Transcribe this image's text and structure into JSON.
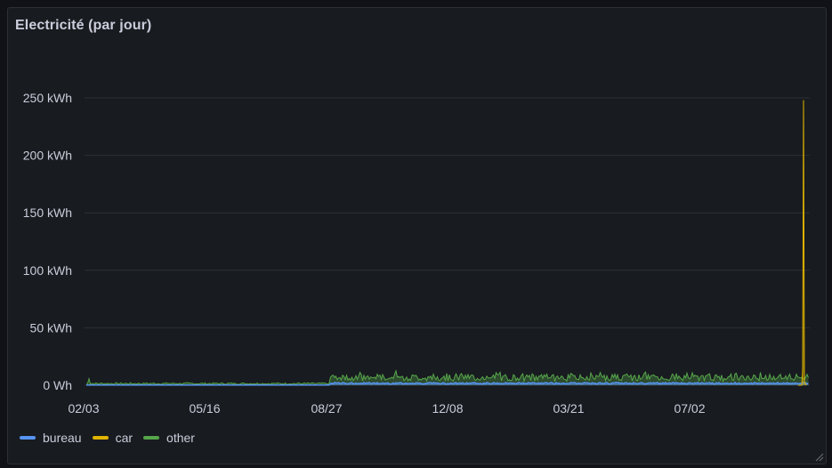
{
  "panel": {
    "title": "Electricité (par jour)"
  },
  "colors": {
    "background": "#111217",
    "panel": "#181b1f",
    "grid": "#2c2f36",
    "text": "#ccccdc",
    "bureau": "#5794f2",
    "car": "#e0b400",
    "other": "#56a64b"
  },
  "icons": {
    "resize": "resize-handle-icon"
  },
  "chart_data": {
    "type": "area",
    "title": "Electricité (par jour)",
    "ylim": [
      0,
      250
    ],
    "y_unit": "kWh",
    "y_ticks": [
      "0 Wh",
      "50 kWh",
      "100 kWh",
      "150 kWh",
      "200 kWh",
      "250 kWh"
    ],
    "y_tick_values": [
      0,
      50,
      100,
      150,
      200,
      250
    ],
    "x_ticks": [
      "02/03",
      "05/16",
      "08/27",
      "12/08",
      "03/21",
      "07/02"
    ],
    "legend_placement": "bottom-left",
    "grid": true,
    "series": [
      {
        "name": "bureau",
        "color": "#5794f2",
        "segments": [
          {
            "from": "02/03",
            "to": "08/27",
            "approx_value": 0.3
          },
          {
            "from": "08/27",
            "to": "end",
            "approx_value": 2
          }
        ]
      },
      {
        "name": "car",
        "color": "#e0b400",
        "segments": [
          {
            "from": "02/03",
            "to": "end",
            "approx_value": 0
          }
        ],
        "peak": {
          "position": "end",
          "value": 248
        }
      },
      {
        "name": "other",
        "color": "#56a64b",
        "segments": [
          {
            "from": "02/03",
            "to": "08/27",
            "approx_value": 1.5
          },
          {
            "from": "08/27",
            "to": "end",
            "approx_value": 7
          }
        ]
      }
    ]
  }
}
